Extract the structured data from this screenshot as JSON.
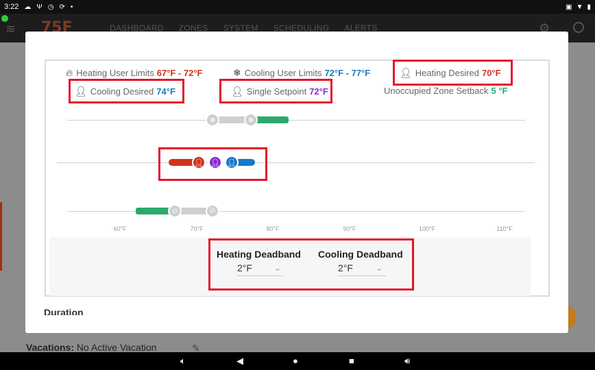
{
  "status_bar": {
    "time": "3:22",
    "icons": [
      "cloud-icon",
      "usb-icon",
      "clock-icon",
      "sync-icon"
    ]
  },
  "header": {
    "logo": "75F",
    "nav": [
      "DASHBOARD",
      "ZONES",
      "SYSTEM",
      "SCHEDULING",
      "ALERTS"
    ]
  },
  "modal": {
    "legend": {
      "heating_limits_label": "Heating User Limits",
      "heating_limits_value": "67°F - 72°F",
      "cooling_limits_label": "Cooling User Limits",
      "cooling_limits_value": "72°F - 77°F",
      "heating_desired_label": "Heating Desired",
      "heating_desired_value": "70°F",
      "cooling_desired_label": "Cooling Desired",
      "cooling_desired_value": "74°F",
      "single_setpoint_label": "Single Setpoint",
      "single_setpoint_value": "72°F",
      "setback_label": "Unoccupied Zone Setback",
      "setback_value": "5 °F"
    },
    "axis_ticks": [
      "60°F",
      "70°F",
      "80°F",
      "90°F",
      "100°F",
      "110°F"
    ],
    "deadbands": {
      "heating_title": "Heating Deadband",
      "heating_value": "2°F",
      "cooling_title": "Cooling Deadband",
      "cooling_value": "2°F"
    },
    "duration_label": "Duration"
  },
  "background": {
    "vacations_label": "Vacations:",
    "vacations_value": "No Active Vacation"
  },
  "colors": {
    "heating": "#d0321e",
    "cooling": "#1a78c8",
    "setpoint": "#8a2bd0",
    "setback": "#2aaa6a",
    "highlight": "#e5142a"
  }
}
